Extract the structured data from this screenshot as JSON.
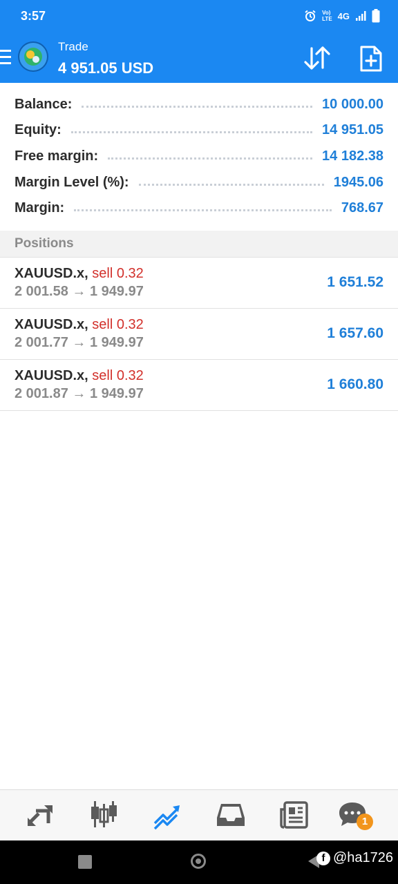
{
  "status_bar": {
    "time": "3:57",
    "network_top": "Vo)",
    "network_bottom": "LTE",
    "signal_label": "4G"
  },
  "app_bar": {
    "title": "Trade",
    "subtitle": "4 951.05 USD",
    "icons": [
      "menu-icon",
      "metatrader-logo",
      "sort-icon",
      "new-order-icon"
    ]
  },
  "summary": [
    {
      "label": "Balance:",
      "value": "10 000.00"
    },
    {
      "label": "Equity:",
      "value": "14 951.05"
    },
    {
      "label": "Free margin:",
      "value": "14 182.38"
    },
    {
      "label": "Margin Level (%):",
      "value": "1945.06"
    },
    {
      "label": "Margin:",
      "value": "768.67"
    }
  ],
  "positions_header": "Positions",
  "positions": [
    {
      "symbol": "XAUUSD.x,",
      "side": "sell 0.32",
      "prices": "2 001.58 → 1 949.97",
      "profit": "1 651.52"
    },
    {
      "symbol": "XAUUSD.x,",
      "side": "sell 0.32",
      "prices": "2 001.77 → 1 949.97",
      "profit": "1 657.60"
    },
    {
      "symbol": "XAUUSD.x,",
      "side": "sell 0.32",
      "prices": "2 001.87 → 1 949.97",
      "profit": "1 660.80"
    }
  ],
  "bottom_nav": {
    "items": [
      "quotes-icon",
      "chart-icon",
      "trade-icon",
      "history-icon",
      "news-icon",
      "chat-icon"
    ],
    "active": "trade-icon",
    "chat_badge": "1"
  },
  "watermark": {
    "icon": "facebook-icon",
    "text": "@ha1726"
  },
  "colors": {
    "primary": "#1b88f2",
    "value_blue": "#1f7fd8",
    "sell_red": "#d2302b",
    "badge_orange": "#f2951c"
  }
}
